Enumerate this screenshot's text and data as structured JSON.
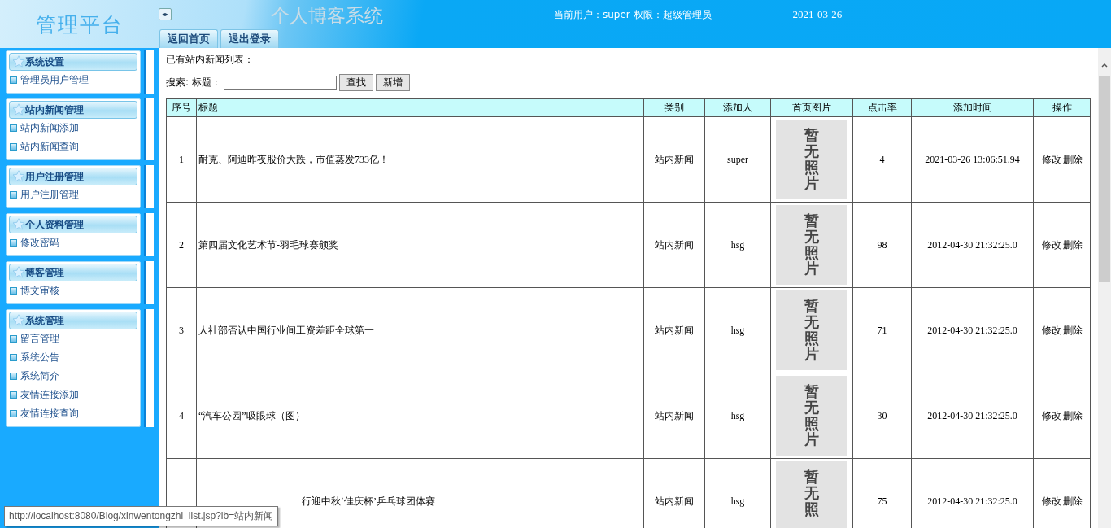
{
  "header": {
    "logo": "管理平台",
    "title": "个人博客系统",
    "toggle": "◂▸",
    "user_info": "当前用户：super 权限：超级管理员",
    "date": "2021-03-26",
    "tabs": [
      {
        "label": "返回首页",
        "selected": false
      },
      {
        "label": "退出登录",
        "selected": false
      }
    ]
  },
  "sidebar": {
    "groups": [
      {
        "title": "系统设置",
        "items": [
          "管理员用户管理"
        ]
      },
      {
        "title": "站内新闻管理",
        "items": [
          "站内新闻添加",
          "站内新闻查询"
        ]
      },
      {
        "title": "用户注册管理",
        "items": [
          "用户注册管理"
        ]
      },
      {
        "title": "个人资料管理",
        "items": [
          "修改密码"
        ]
      },
      {
        "title": "博客管理",
        "items": [
          "博文审核"
        ]
      },
      {
        "title": "系统管理",
        "items": [
          "留言管理",
          "系统公告",
          "系统简介",
          "友情连接添加",
          "友情连接查询"
        ]
      }
    ]
  },
  "content": {
    "heading": "已有站内新闻列表：",
    "search": {
      "label": "搜索: 标题：",
      "buttons": [
        "查找",
        "新增"
      ]
    },
    "table": {
      "columns": [
        "序号",
        "标题",
        "类别",
        "添加人",
        "首页图片",
        "点击率",
        "添加时间",
        "操作"
      ],
      "rows": [
        {
          "no": "1",
          "title": "耐克、阿迪昨夜股价大跌，市值蒸发733亿！",
          "category": "站内新闻",
          "author": "super",
          "photo": "暂无照片",
          "clicks": "4",
          "time": "2021-03-26 13:06:51.94",
          "actions": [
            "修改",
            "删除"
          ]
        },
        {
          "no": "2",
          "title": "第四届文化艺术节-羽毛球赛颁奖",
          "category": "站内新闻",
          "author": "hsg",
          "photo": "暂无照片",
          "clicks": "98",
          "time": "2012-04-30 21:32:25.0",
          "actions": [
            "修改",
            "删除"
          ]
        },
        {
          "no": "3",
          "title": "人社部否认中国行业间工资差距全球第一",
          "category": "站内新闻",
          "author": "hsg",
          "photo": "暂无照片",
          "clicks": "71",
          "time": "2012-04-30 21:32:25.0",
          "actions": [
            "修改",
            "删除"
          ]
        },
        {
          "no": "4",
          "title": "“汽车公园”吸眼球（图）",
          "category": "站内新闻",
          "author": "hsg",
          "photo": "暂无照片",
          "clicks": "30",
          "time": "2012-04-30 21:32:25.0",
          "actions": [
            "修改",
            "删除"
          ]
        },
        {
          "kind": "covered",
          "title": "行迎中秋‘佳庆杯’乒乓球团体赛",
          "category": "站内新闻",
          "author": "hsg",
          "photo": "暂无照",
          "clicks": "75",
          "time": "2012-04-30 21:32:25.0",
          "actions": [
            "修改",
            "删除"
          ]
        }
      ]
    }
  },
  "status_tooltip": "http://localhost:8080/Blog/xinwentongzhi_list.jsp?lb=站内新闻"
}
